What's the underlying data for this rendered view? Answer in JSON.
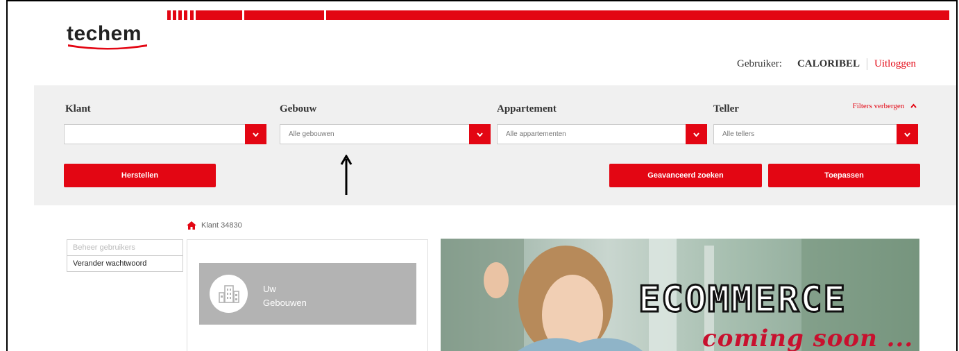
{
  "brand": {
    "name": "techem",
    "accent": "#e30613"
  },
  "user": {
    "label": "Gebruiker:",
    "name": "CALORIBEL",
    "logout": "Uitloggen"
  },
  "filters": {
    "hide_label": "Filters verbergen",
    "client": {
      "label": "Klant",
      "value": ""
    },
    "building": {
      "label": "Gebouw",
      "placeholder": "Alle gebouwen"
    },
    "apartment": {
      "label": "Appartement",
      "placeholder": "Alle appartementen"
    },
    "meter": {
      "label": "Teller",
      "placeholder": "Alle tellers"
    },
    "buttons": {
      "reset": "Herstellen",
      "advanced": "Geavanceerd zoeken",
      "apply": "Toepassen"
    }
  },
  "breadcrumb": {
    "label": "Klant 34830"
  },
  "sidemenu": {
    "items": [
      "Beheer gebruikers",
      "Verander wachtwoord"
    ]
  },
  "tile": {
    "line1": "Uw",
    "line2": "Gebouwen"
  },
  "banner": {
    "title": "ECOMMERCE",
    "subtitle": "coming soon ..."
  },
  "icons": {
    "home": "home-icon",
    "dropdown": "chevron-down-icon",
    "collapse": "chevron-up-icon",
    "buildings": "buildings-icon"
  }
}
